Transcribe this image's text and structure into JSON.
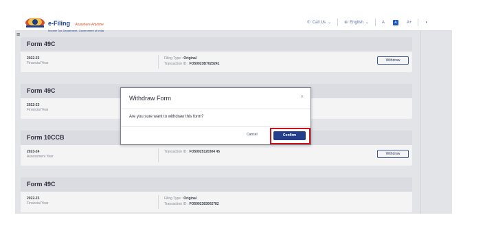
{
  "header": {
    "brand_title": "e-Filing",
    "brand_tagline": "Anywhere Anytime",
    "brand_sub": "Income Tax Department, Government of India",
    "call_us": "Call Us",
    "language": "English",
    "font_small": "A",
    "font_large": "A+",
    "font_box": "A"
  },
  "cards": [
    {
      "title": "Form 49C",
      "year": "2022-23",
      "year_label": "Financial Year",
      "filing_type_label": "Filing Type : ",
      "filing_type": "Original",
      "txn_label": "Transaction ID : ",
      "txn_id": "FO50023B7023241",
      "button": "Withdraw"
    },
    {
      "title": "Form 49C",
      "year": "2022-23",
      "year_label": "Financial Year"
    },
    {
      "title": "Form 10CCB",
      "year": "2023-24",
      "year_label": "Assessment Year",
      "txn_label": "Transaction ID : ",
      "txn_id": "FO50025120304 45",
      "button": "Withdraw"
    },
    {
      "title": "Form 49C",
      "year": "2022-23",
      "year_label": "Financial Year",
      "filing_type_label": "Filing Type : ",
      "filing_type": "Original",
      "txn_label": "Transaction ID : ",
      "txn_id": "FO5002383002782"
    }
  ],
  "modal": {
    "title": "Withdraw Form",
    "close_glyph": "×",
    "message": "Are you sure want to withdraw this form?",
    "cancel": "Cancel",
    "confirm": "Confirm"
  },
  "colors": {
    "primary": "#233e8a",
    "highlight": "#c8141c",
    "card_header": "#e4e6ec"
  }
}
